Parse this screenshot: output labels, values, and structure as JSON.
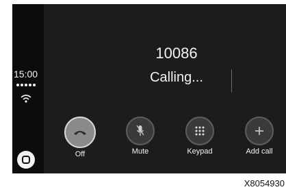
{
  "status_bar": {
    "time": "15:00"
  },
  "call": {
    "number": "10086",
    "status": "Calling..."
  },
  "controls": [
    {
      "label": "Off",
      "icon": "hang-up-icon"
    },
    {
      "label": "Mute",
      "icon": "microphone-icon"
    },
    {
      "label": "Keypad",
      "icon": "keypad-icon"
    },
    {
      "label": "Add call",
      "icon": "plus-icon"
    }
  ],
  "figure_code": "X8054930",
  "colors": {
    "screen_bg": "#1c1c1c",
    "sidebar_bg": "#0c0c0c",
    "hangup_button": "#8a8a8a",
    "button_bg": "#3a3a3a"
  }
}
